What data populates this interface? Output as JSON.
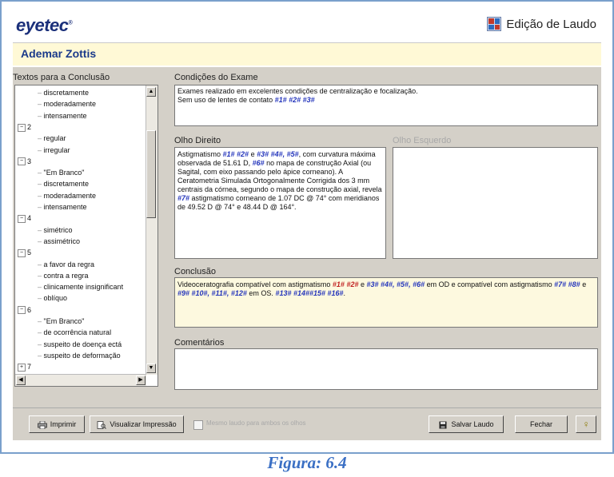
{
  "header": {
    "logo": "eyetec",
    "logo_mark": "®",
    "title": "Edição de Laudo",
    "title_icon": "report-icon"
  },
  "patient": {
    "name": "Ademar Zottis"
  },
  "tree": {
    "label": "Textos para a Conclusão",
    "items": [
      {
        "text": "discretamente",
        "node": ""
      },
      {
        "text": "moderadamente",
        "node": ""
      },
      {
        "text": "intensamente",
        "node": ""
      },
      {
        "text": "2",
        "node": "−"
      },
      {
        "text": "regular",
        "node": ""
      },
      {
        "text": "irregular",
        "node": ""
      },
      {
        "text": "3",
        "node": "−"
      },
      {
        "text": "\"Em Branco\"",
        "node": ""
      },
      {
        "text": "discretamente",
        "node": ""
      },
      {
        "text": "moderadamente",
        "node": ""
      },
      {
        "text": "intensamente",
        "node": ""
      },
      {
        "text": "4",
        "node": "−"
      },
      {
        "text": "simétrico",
        "node": ""
      },
      {
        "text": "assimétrico",
        "node": ""
      },
      {
        "text": "5",
        "node": "−"
      },
      {
        "text": "a favor da regra",
        "node": ""
      },
      {
        "text": "contra a regra",
        "node": ""
      },
      {
        "text": "clinicamente insignificant",
        "node": ""
      },
      {
        "text": "oblíquo",
        "node": ""
      },
      {
        "text": "6",
        "node": "−"
      },
      {
        "text": "\"Em Branco\"",
        "node": ""
      },
      {
        "text": "de ocorrência natural",
        "node": ""
      },
      {
        "text": "suspeito de doença ectá",
        "node": ""
      },
      {
        "text": "suspeito de deformação",
        "node": ""
      },
      {
        "text": "7",
        "node": "+"
      }
    ]
  },
  "conditions": {
    "label": "Condições do Exame",
    "line1": "Exames realizado em excelentes condições de centralização e focalização.",
    "line2_a": "Sem uso de lentes de contato ",
    "line2_b": "#1# #2# #3#"
  },
  "right_eye": {
    "label": "Olho Direito",
    "p1": "Astigmatismo ",
    "v1": "#1# #2#",
    "p2": " e ",
    "v2": "#3# #4#, #5#",
    "p3": ", com curvatura máxima observada de 51.61 D, ",
    "v3": "#6#",
    "p4": " no mapa de construção Axial (ou Sagital, com eixo passando pelo ápice corneano). A Ceratometria Simulada Ortogonalmente Corrigida dos 3 mm centrais da córnea, segundo o mapa de construção axial, revela ",
    "v4": "#7#",
    "p5": " astigmatismo corneano de 1.07 DC @ 74° com meridianos de 49.52 D @ 74° e 48.44 D @ 164°."
  },
  "left_eye": {
    "label": "Olho Esquerdo"
  },
  "conclusion": {
    "label": "Conclusão",
    "p1": "Videoceratografia compatível com astigmatismo ",
    "v1": "#1#",
    "v2": "#2#",
    "p2": " e ",
    "v3": "#3# #4#, #5#, #6#",
    "p3": " em OD e compatível com astigmatismo ",
    "v4": "#7# #8#",
    "p4": " e ",
    "v5": "#9# #10#, #11#, #12#",
    "p5": " em OS. ",
    "v6": "#13# #14##15# #16#",
    "p6": "."
  },
  "comments": {
    "label": "Comentários",
    "value": ""
  },
  "buttons": {
    "print": "Imprimir",
    "preview": "Visualizar Impressão",
    "same_report": "Mesmo laudo para ambos os olhos",
    "save": "Salvar Laudo",
    "close": "Fechar",
    "help_icon": "help-icon"
  },
  "caption": "Figura: 6.4"
}
